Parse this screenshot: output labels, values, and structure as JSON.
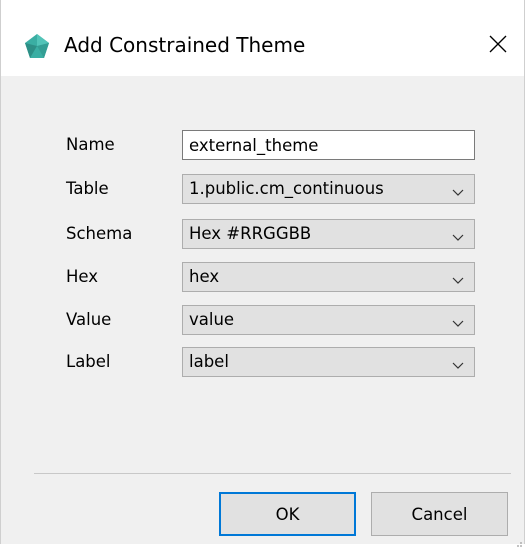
{
  "dialog": {
    "title": "Add Constrained Theme",
    "app_icon": "diamond-logo-icon",
    "close_icon": "close-icon",
    "accent_color": "#0078d7",
    "icon_color": "#3aaea3"
  },
  "form": {
    "name_label": "Name",
    "name_value": "external_theme",
    "table_label": "Table",
    "table_value": "1.public.cm_continuous",
    "schema_label": "Schema",
    "schema_value": "Hex #RRGGBB",
    "hex_label": "Hex",
    "hex_value": "hex",
    "value_label": "Value",
    "value_value": "value",
    "label_label": "Label",
    "label_value": "label"
  },
  "buttons": {
    "ok": "OK",
    "cancel": "Cancel"
  }
}
